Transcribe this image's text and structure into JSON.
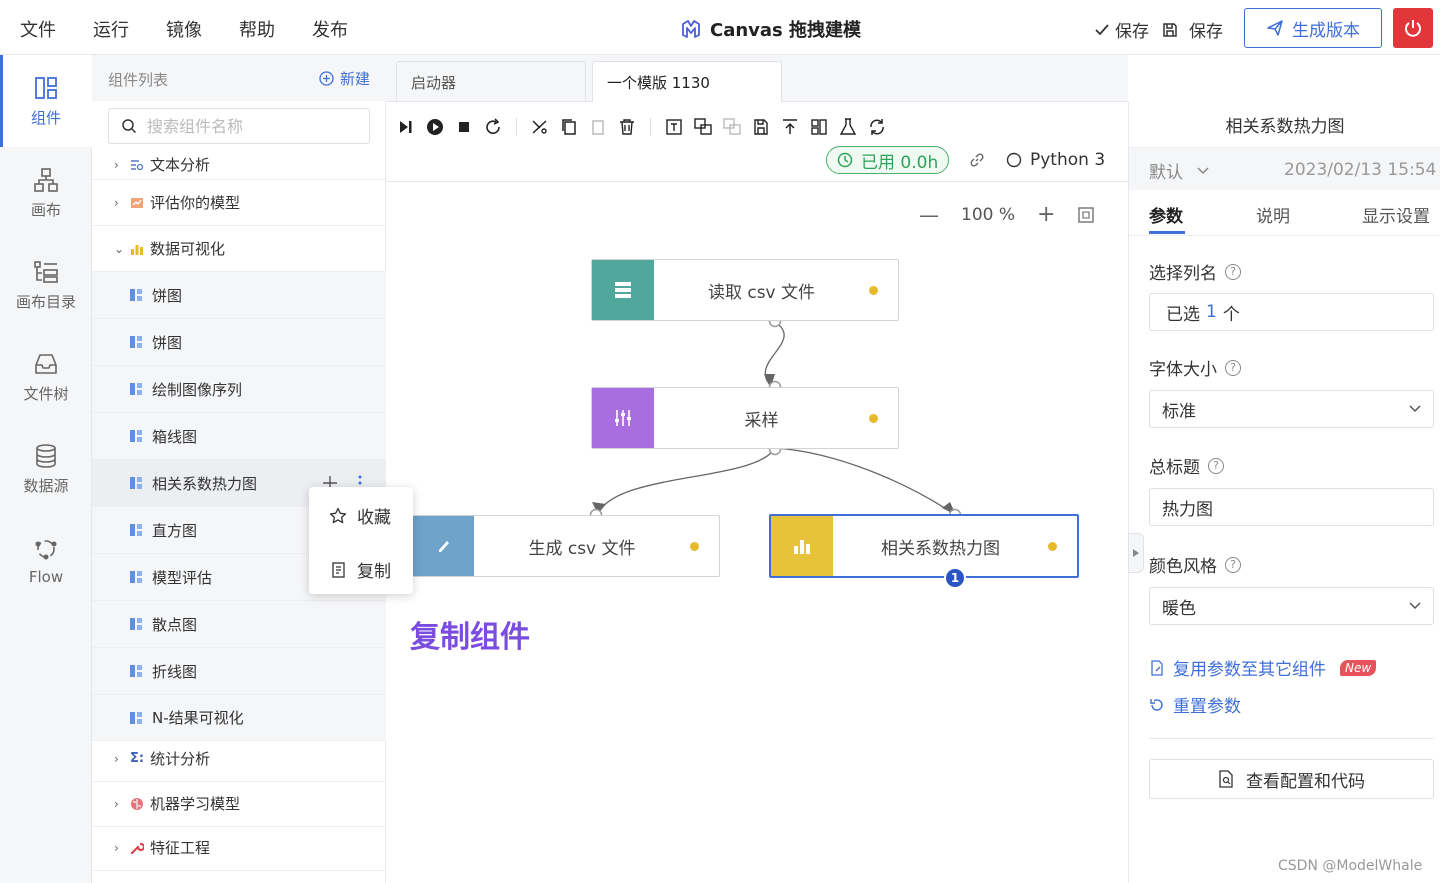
{
  "menu": [
    "文件",
    "运行",
    "镜像",
    "帮助",
    "发布"
  ],
  "app": {
    "title": "Canvas 拖拽建模",
    "save_check": "保存",
    "save": "保存",
    "generate_version": "生成版本"
  },
  "rail": [
    {
      "label": "组件",
      "icon": "component-icon"
    },
    {
      "label": "画布",
      "icon": "canvas-icon"
    },
    {
      "label": "画布目录",
      "icon": "directory-icon"
    },
    {
      "label": "文件树",
      "icon": "file-tree-icon"
    },
    {
      "label": "数据源",
      "icon": "database-icon"
    },
    {
      "label": "Flow",
      "icon": "flow-icon"
    }
  ],
  "components": {
    "title": "组件列表",
    "new_label": "新建",
    "search_placeholder": "搜索组件名称",
    "categories": {
      "text_analysis": "文本分析",
      "evaluate_model": "评估你的模型",
      "data_viz": "数据可视化",
      "stats": "统计分析",
      "ml_models": "机器学习模型",
      "feature_eng": "特征工程"
    },
    "leaves": [
      "饼图",
      "饼图",
      "绘制图像序列",
      "箱线图",
      "相关系数热力图",
      "直方图",
      "模型评估",
      "散点图",
      "折线图",
      "N-结果可视化"
    ]
  },
  "context_menu": {
    "favorite": "收藏",
    "copy": "复制"
  },
  "tabs": [
    "启动器",
    "一个模版 1130"
  ],
  "toolbar": {
    "used": "已用 0.0h",
    "kernel": "Python 3"
  },
  "canvas": {
    "zoom": "100 %",
    "nodes": {
      "read_csv": "读取 csv 文件",
      "sample": "采样",
      "gen_csv": "生成 csv 文件",
      "heatmap": "相关系数热力图"
    },
    "badge_count": "1",
    "annotation": "复制组件"
  },
  "right_panel": {
    "title": "相关系数热力图",
    "preset": "默认",
    "timestamp": "2023/02/13 15:54",
    "tabs": [
      "参数",
      "说明",
      "显示设置"
    ],
    "fields": {
      "columns_label": "选择列名",
      "columns_prefix": "已选",
      "columns_count": "1",
      "columns_suffix": "个",
      "font_size_label": "字体大小",
      "font_size_value": "标准",
      "main_title_label": "总标题",
      "main_title_value": "热力图",
      "color_style_label": "颜色风格",
      "color_style_value": "暖色"
    },
    "reuse_params": "复用参数至其它组件",
    "new_badge": "New",
    "reset_params": "重置参数",
    "view_code": "查看配置和代码"
  },
  "watermark": "CSDN @ModelWhale",
  "colors": {
    "accent": "#3f6fd8",
    "danger": "#e2373a",
    "node_read": "#4fa89b",
    "node_sample": "#a86ee0",
    "node_gencsv": "#6fa3c9",
    "node_heatmap": "#e8c23a",
    "annotation": "#7b4ce0"
  }
}
